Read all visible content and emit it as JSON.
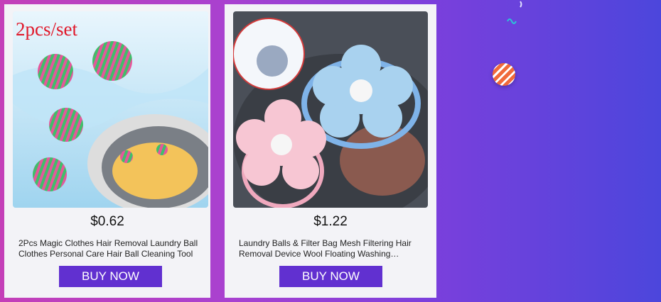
{
  "products": [
    {
      "badge": "2pcs/set",
      "price": "$0.62",
      "title": "2Pcs Magic Clothes Hair Removal Laundry Ball Clothes Personal Care Hair Ball Cleaning Tool",
      "button": "BUY NOW"
    },
    {
      "price": "$1.22",
      "title": "Laundry Balls & Filter Bag Mesh Filtering Hair Removal Device Wool Floating Washing Machine",
      "button": "BUY NOW"
    }
  ],
  "colors": {
    "button": "#6130d0",
    "badge": "#e0182a"
  }
}
